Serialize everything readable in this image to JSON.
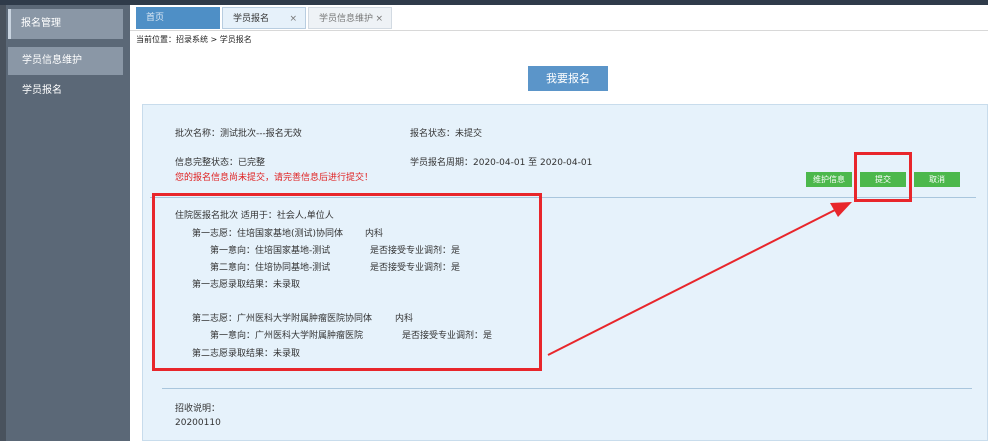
{
  "sidebar": {
    "group": "报名管理",
    "items": [
      {
        "label": "学员信息维护"
      },
      {
        "label": "学员报名"
      }
    ]
  },
  "tabs": [
    {
      "label": "首页"
    },
    {
      "label": "学员报名",
      "close": "×"
    },
    {
      "label": "学员信息维护",
      "close": "×"
    }
  ],
  "breadcrumb": "当前位置：招录系统 > 学员报名",
  "enroll_button": "我要报名",
  "batch": {
    "name": "批次名称：测试批次---报名无效",
    "status": "报名状态：未提交",
    "info_status": "信息完整状态：已完整",
    "period": "学员报名周期：2020-04-01 至 2020-04-01",
    "warning": "您的报名信息尚未提交，请完善信息后进行提交！"
  },
  "buttons": {
    "maintain": "维护信息",
    "submit": "提交",
    "cancel": "取消"
  },
  "choices": {
    "header": "住院医报名批次 适用于：社会人,单位人",
    "first": {
      "title": "第一志愿：住培国家基地(测试)协同体",
      "dept": "内科",
      "i1_name": "第一意向：住培国家基地-测试",
      "i1_accept": "是否接受专业调剂：是",
      "i2_name": "第二意向：住培协同基地-测试",
      "i2_accept": "是否接受专业调剂：是",
      "result": "第一志愿录取结果：未录取"
    },
    "second": {
      "title": "第二志愿：广州医科大学附属肿瘤医院协同体",
      "dept": "内科",
      "i1_name": "第一意向：广州医科大学附属肿瘤医院",
      "i1_accept": "是否接受专业调剂：是",
      "result": "第二志愿录取结果：未录取"
    }
  },
  "recruit": {
    "label": "招收说明：",
    "value": "20200110"
  },
  "colors": {
    "sidebar": "#5b6877",
    "panel": "#e6f2fb",
    "primary": "#5b95c9",
    "green": "#4cb84c",
    "annotation": "#e8262b"
  }
}
